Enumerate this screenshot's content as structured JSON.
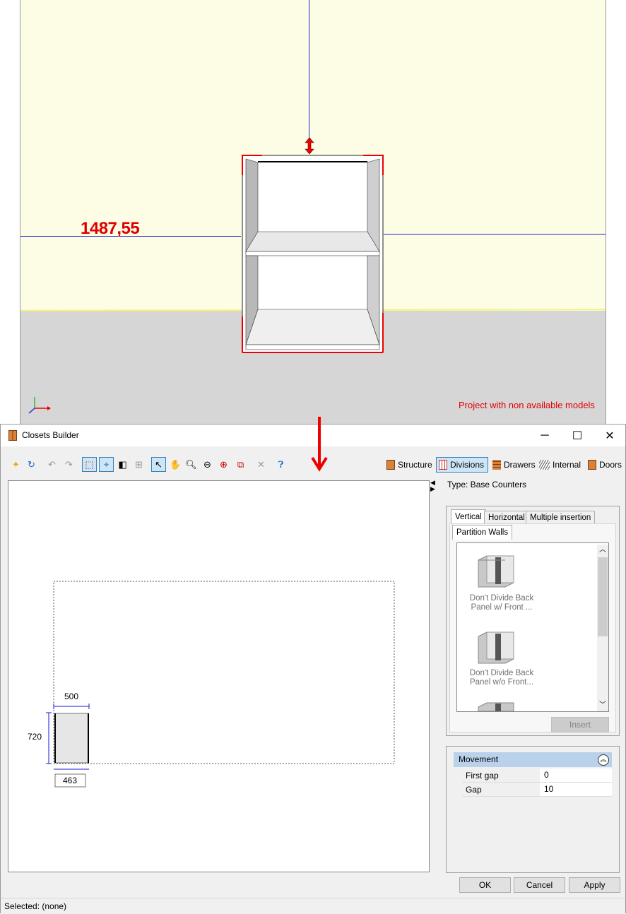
{
  "viewport": {
    "dimension_label": "1487,55",
    "warning": "Project with non available models"
  },
  "dialog": {
    "title": "Closets Builder",
    "window_buttons": {
      "minimize": "─",
      "maximize": "☐",
      "close": "✕"
    },
    "main_tabs": [
      {
        "label": "Structure",
        "selected": false
      },
      {
        "label": "Divisions",
        "selected": true
      },
      {
        "label": "Drawers",
        "selected": false
      },
      {
        "label": "Internal",
        "selected": false
      },
      {
        "label": "Doors",
        "selected": false
      }
    ],
    "type_label": "Type: Base Counters",
    "sub_tabs": [
      "Vertical",
      "Horizontal",
      "Multiple insertion"
    ],
    "inner_tab": "Partition Walls",
    "items": [
      {
        "label": "Don't Divide Back Panel w/ Front ..."
      },
      {
        "label": "Don't Divide Back Panel w/o Front..."
      }
    ],
    "insert_label": "Insert",
    "movement": {
      "header": "Movement",
      "rows": [
        {
          "name": "First gap",
          "value": "0"
        },
        {
          "name": "Gap",
          "value": "10"
        }
      ]
    },
    "canvas": {
      "width_dim": "500",
      "height_dim": "720",
      "depth_dim": "463"
    },
    "buttons": {
      "ok": "OK",
      "cancel": "Cancel",
      "apply": "Apply"
    },
    "status": "Selected: (none)"
  },
  "colors": {
    "wall": "#fdfde6",
    "floor": "#d6d6d6",
    "dimension": "#e00000",
    "axis_line": "#2222cc",
    "selection": "#cde6f7"
  }
}
